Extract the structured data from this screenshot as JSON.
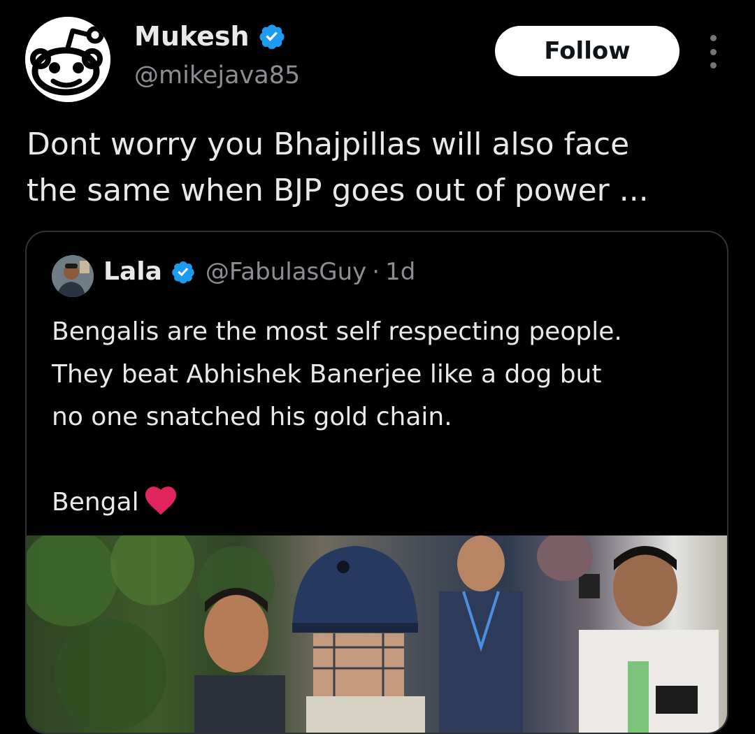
{
  "author": {
    "name": "Mukesh",
    "handle": "@mikejava85",
    "avatar_icon": "reddit-alien-icon",
    "verified_icon": "verified-badge-icon"
  },
  "actions": {
    "follow_label": "Follow",
    "more_icon": "more-vertical-icon"
  },
  "tweet": {
    "text_line1": "Dont worry you Bhajpillas will also face",
    "text_line2": "the same when BJP goes out of power ..."
  },
  "quoted_tweet": {
    "name": "Lala",
    "handle": "@FabulasGuy",
    "separator": "·",
    "time": "1d",
    "text_line1": "Bengalis are the most self respecting people.",
    "text_line2": "They beat Abhishek Banerjee like a dog but",
    "text_line3": "no one snatched his gold chain.",
    "text_line4": "Bengal",
    "emoji_icon": "red-heart-icon"
  },
  "colors": {
    "background": "#000000",
    "text": "#e7e9ea",
    "secondary_text": "#8b8f94",
    "verified_blue": "#1d9bf0",
    "border": "#2f3336"
  }
}
